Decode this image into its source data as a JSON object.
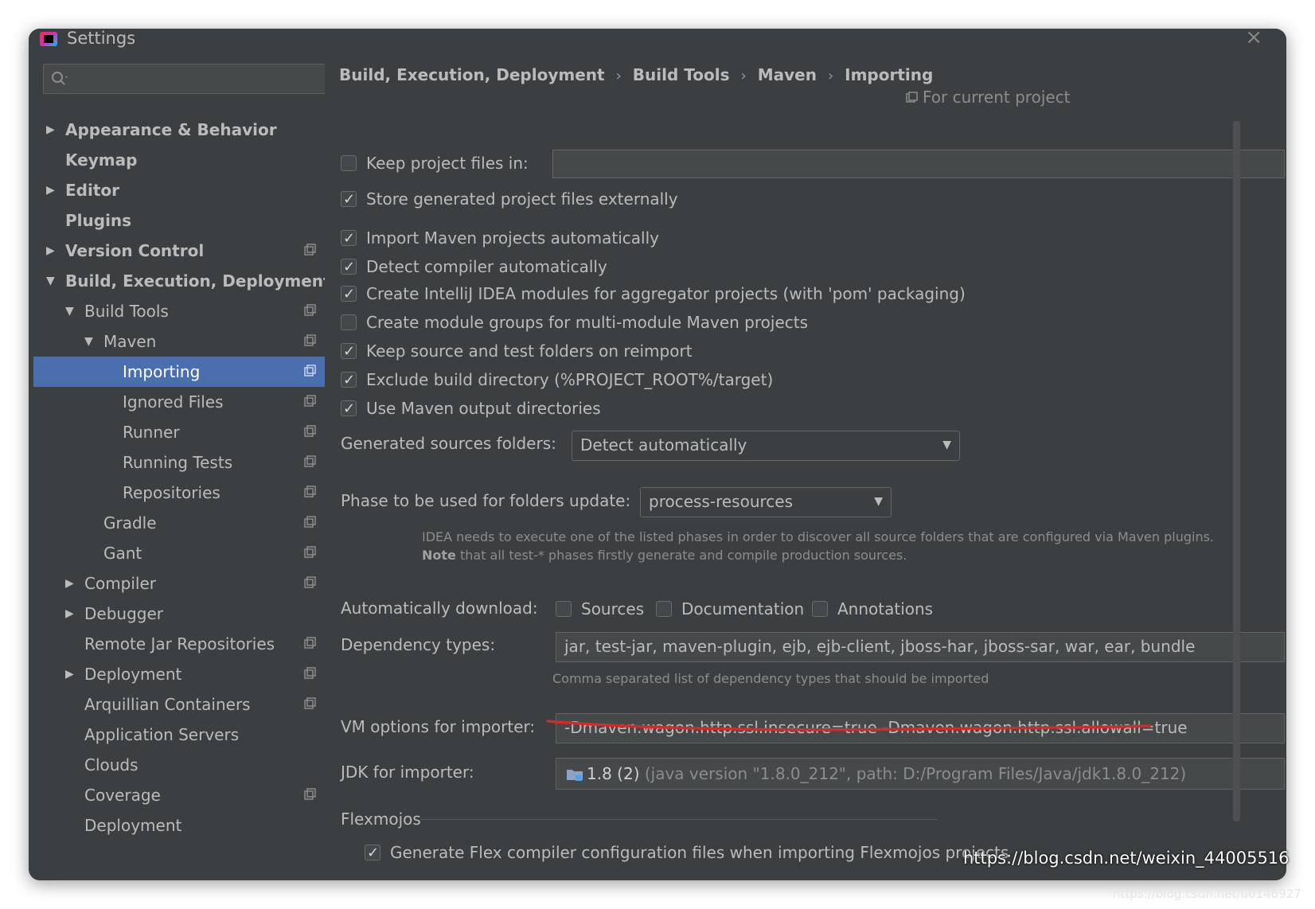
{
  "window": {
    "title": "Settings"
  },
  "search": {
    "placeholder": ""
  },
  "sidebar": {
    "items": [
      {
        "label": "Appearance & Behavior",
        "arrow": "▶",
        "bold": true
      },
      {
        "label": "Keymap",
        "arrow": "",
        "bold": true
      },
      {
        "label": "Editor",
        "arrow": "▶",
        "bold": true
      },
      {
        "label": "Plugins",
        "arrow": "",
        "bold": true
      },
      {
        "label": "Version Control",
        "arrow": "▶",
        "bold": true
      },
      {
        "label": "Build, Execution, Deployment",
        "arrow": "▼",
        "bold": true
      },
      {
        "label": "Build Tools",
        "arrow": "▼",
        "bold": false
      },
      {
        "label": "Maven",
        "arrow": "▼",
        "bold": false
      },
      {
        "label": "Importing",
        "arrow": "",
        "bold": false,
        "selected": true
      },
      {
        "label": "Ignored Files",
        "arrow": "",
        "bold": false
      },
      {
        "label": "Runner",
        "arrow": "",
        "bold": false
      },
      {
        "label": "Running Tests",
        "arrow": "",
        "bold": false
      },
      {
        "label": "Repositories",
        "arrow": "",
        "bold": false
      },
      {
        "label": "Gradle",
        "arrow": "",
        "bold": false
      },
      {
        "label": "Gant",
        "arrow": "",
        "bold": false
      },
      {
        "label": "Compiler",
        "arrow": "▶",
        "bold": false
      },
      {
        "label": "Debugger",
        "arrow": "▶",
        "bold": false
      },
      {
        "label": "Remote Jar Repositories",
        "arrow": "",
        "bold": false
      },
      {
        "label": "Deployment",
        "arrow": "▶",
        "bold": false
      },
      {
        "label": "Arquillian Containers",
        "arrow": "",
        "bold": false
      },
      {
        "label": "Application Servers",
        "arrow": "",
        "bold": false
      },
      {
        "label": "Clouds",
        "arrow": "",
        "bold": false
      },
      {
        "label": "Coverage",
        "arrow": "",
        "bold": false
      },
      {
        "label": "Deployment",
        "arrow": "",
        "bold": false
      }
    ]
  },
  "breadcrumb": [
    "Build, Execution, Deployment",
    "Build Tools",
    "Maven",
    "Importing"
  ],
  "breadcrumb_sep": "›",
  "for_current_project": "For current project",
  "options": {
    "keep_project_files": {
      "label": "Keep project files in:",
      "checked": false,
      "value": ""
    },
    "store_externally": {
      "label": "Store generated project files externally",
      "checked": true
    },
    "import_auto": {
      "label": "Import Maven projects automatically",
      "checked": true
    },
    "detect_compiler": {
      "label": "Detect compiler automatically",
      "checked": true
    },
    "create_modules": {
      "label": "Create IntelliJ IDEA modules for aggregator projects (with 'pom' packaging)",
      "checked": true
    },
    "create_groups": {
      "label": "Create module groups for multi-module Maven projects",
      "checked": false
    },
    "keep_source": {
      "label": "Keep source and test folders on reimport",
      "checked": true
    },
    "exclude_build": {
      "label": "Exclude build directory (%PROJECT_ROOT%/target)",
      "checked": true
    },
    "use_output": {
      "label": "Use Maven output directories",
      "checked": true
    }
  },
  "generated_sources": {
    "label": "Generated sources folders:",
    "value": "Detect automatically"
  },
  "phase": {
    "label": "Phase to be used for folders update:",
    "value": "process-resources"
  },
  "phase_hint": {
    "line1": "IDEA needs to execute one of the listed phases in order to discover all source folders that are configured via Maven plugins.",
    "note_bold": "Note",
    "line2": " that all test-* phases firstly generate and compile production sources."
  },
  "auto_download": {
    "label": "Automatically download:",
    "sources": {
      "label": "Sources",
      "checked": false
    },
    "documentation": {
      "label": "Documentation",
      "checked": false
    },
    "annotations": {
      "label": "Annotations",
      "checked": false
    }
  },
  "dependency_types": {
    "label": "Dependency types:",
    "value": "jar, test-jar, maven-plugin, ejb, ejb-client, jboss-har, jboss-sar, war, ear, bundle",
    "hint": "Comma separated list of dependency types that should be imported"
  },
  "vm_options": {
    "label": "VM options for importer:",
    "value": "-Dmaven.wagon.http.ssl.insecure=true -Dmaven.wagon.http.ssl.allowall=true"
  },
  "jdk": {
    "label": "JDK for importer:",
    "name": "1.8 (2)",
    "detail": " (java version \"1.8.0_212\", path: D:/Program Files/Java/jdk1.8.0_212)"
  },
  "flexmojos": {
    "title": "Flexmojos",
    "generate": {
      "label": "Generate Flex compiler configuration files when importing Flexmojos projects",
      "checked": true
    }
  },
  "watermark": "https://blog.csdn.net/weixin_44005516",
  "watermark2": "https://blog.csdn.net/u0146927",
  "colors": {
    "selection": "#4b6eaf",
    "background": "#3c3f41",
    "annotation_red": "#d32a2a"
  }
}
